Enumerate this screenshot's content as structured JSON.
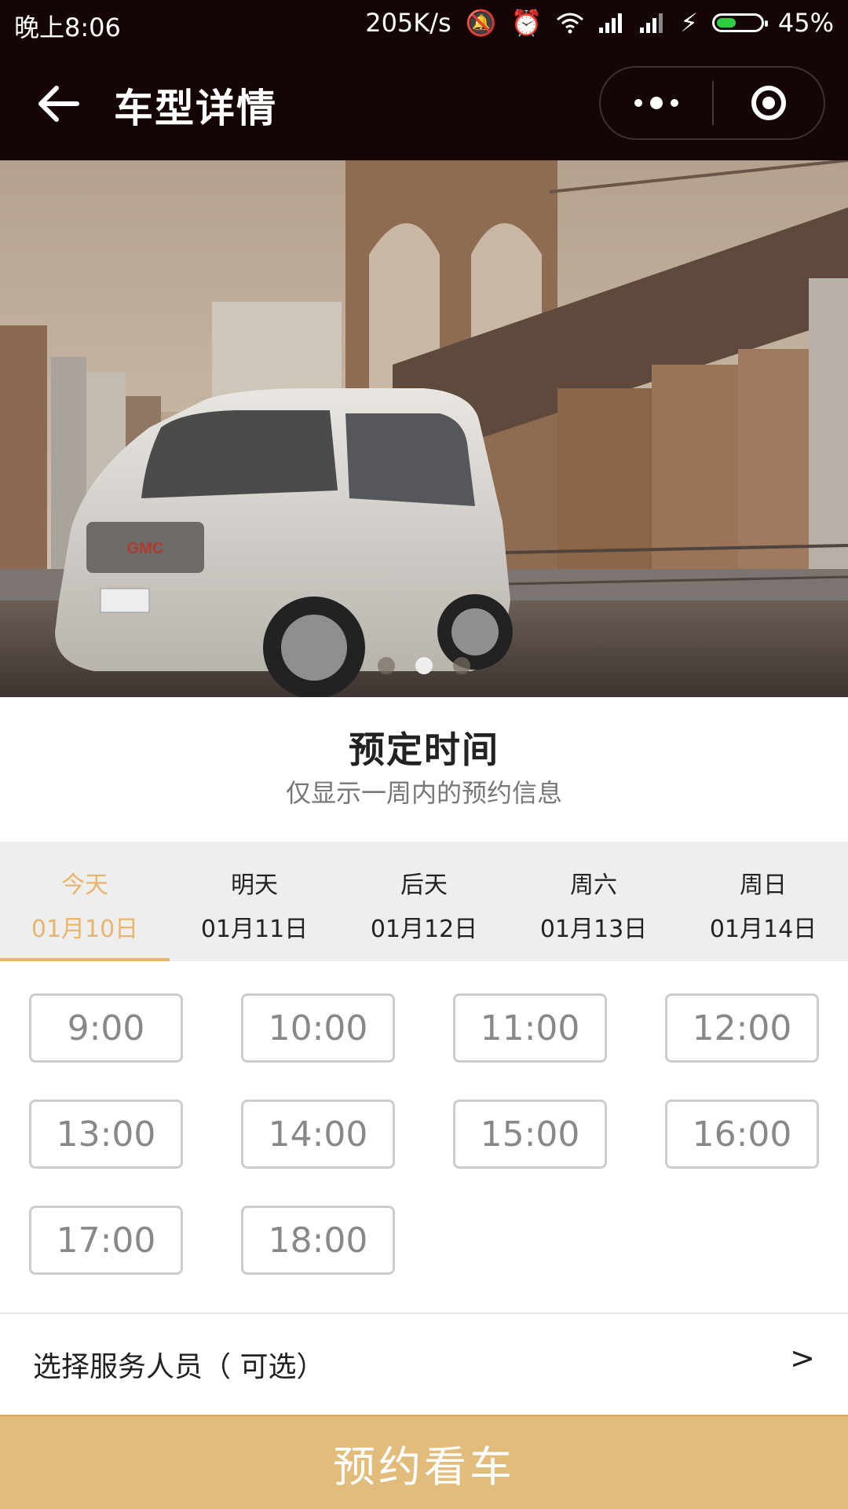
{
  "status_bar": {
    "time": "晚上8:06",
    "network_speed": "205K/s",
    "battery_percent": "45%",
    "battery_level": 0.45
  },
  "nav": {
    "title": "车型详情"
  },
  "banner": {
    "slide_count": 3,
    "active_slide": 1
  },
  "booking": {
    "title": "预定时间",
    "subtitle": "仅显示一周内的预约信息",
    "dates": [
      {
        "day": "今天",
        "date": "01月10日",
        "active": true
      },
      {
        "day": "明天",
        "date": "01月11日",
        "active": false
      },
      {
        "day": "后天",
        "date": "01月12日",
        "active": false
      },
      {
        "day": "周六",
        "date": "01月13日",
        "active": false
      },
      {
        "day": "周日",
        "date": "01月14日",
        "active": false
      }
    ],
    "time_slots": [
      "9:00",
      "10:00",
      "11:00",
      "12:00",
      "13:00",
      "14:00",
      "15:00",
      "16:00",
      "17:00",
      "18:00"
    ]
  },
  "staff": {
    "label": "选择服务人员（ 可选）",
    "chevron": ">"
  },
  "action": {
    "book_label": "预约看车"
  },
  "colors": {
    "accent": "#e8b56b",
    "button": "#e2bc7b",
    "nav_bg": "#150605"
  }
}
